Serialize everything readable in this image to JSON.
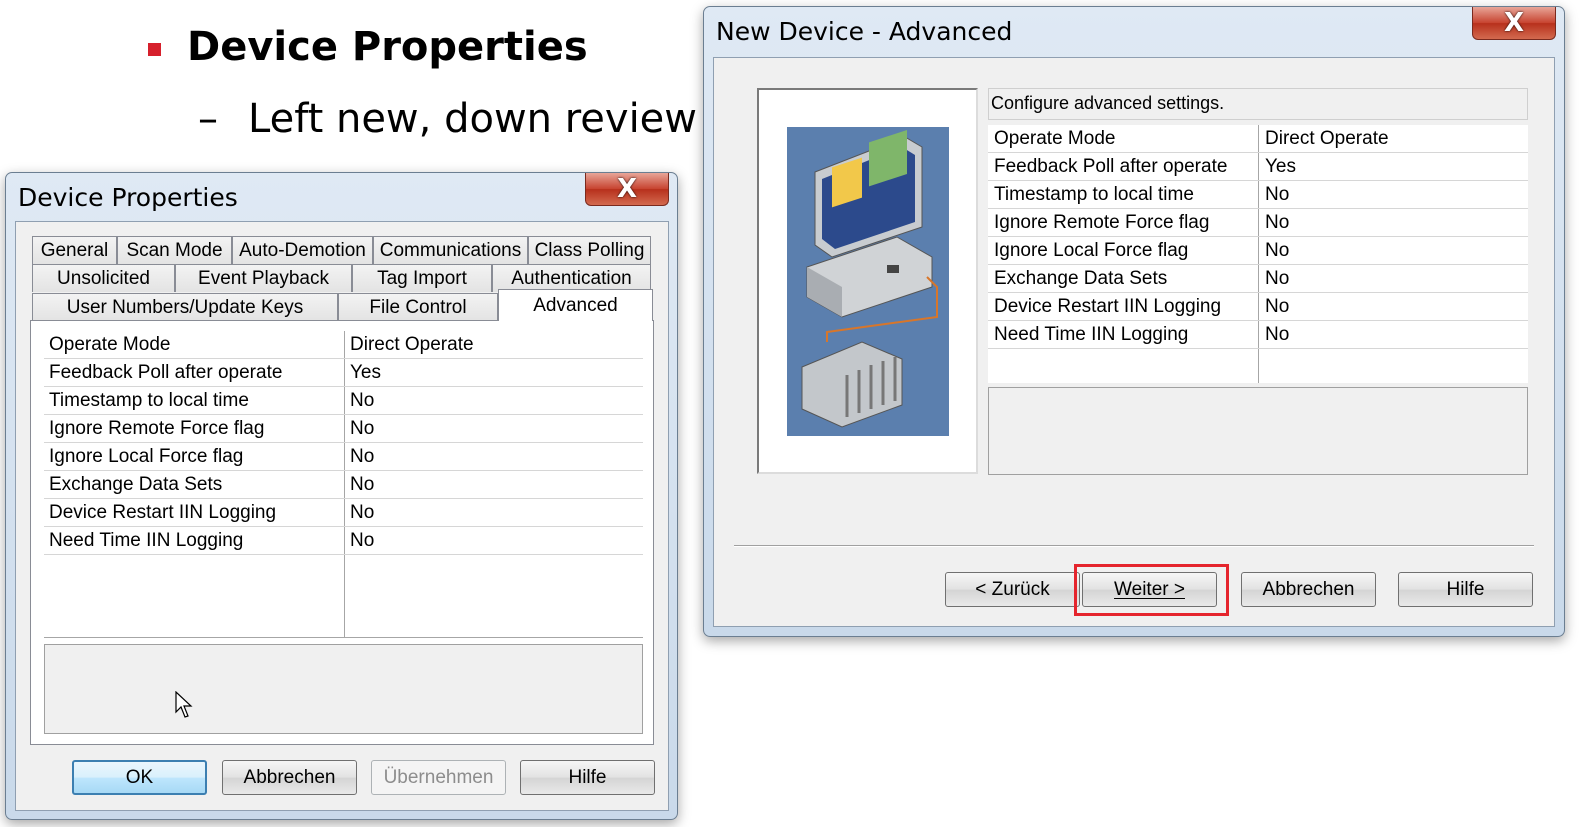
{
  "slide": {
    "bullet": "Device Properties",
    "sub_dash": "–",
    "sub": "Left new, down review"
  },
  "device_properties": {
    "title": "Device Properties",
    "close_label": "X",
    "tabs_row1": [
      "General",
      "Scan Mode",
      "Auto-Demotion",
      "Communications",
      "Class Polling"
    ],
    "tabs_row2": [
      "Unsolicited",
      "Event Playback",
      "Tag Import",
      "Authentication"
    ],
    "tabs_row3": [
      "User Numbers/Update Keys",
      "File Control",
      "Advanced"
    ],
    "active_tab": "Advanced",
    "properties": [
      {
        "name": "Operate Mode",
        "value": "Direct Operate"
      },
      {
        "name": "Feedback Poll after operate",
        "value": "Yes"
      },
      {
        "name": "Timestamp to local time",
        "value": "No"
      },
      {
        "name": "Ignore Remote Force flag",
        "value": "No"
      },
      {
        "name": "Ignore Local Force flag",
        "value": "No"
      },
      {
        "name": "Exchange Data Sets",
        "value": "No"
      },
      {
        "name": "Device Restart IIN Logging",
        "value": "No"
      },
      {
        "name": "Need Time IIN Logging",
        "value": "No"
      }
    ],
    "buttons": {
      "ok": "OK",
      "cancel": "Abbrechen",
      "apply": "Übernehmen",
      "help": "Hilfe"
    }
  },
  "new_device": {
    "title": "New Device - Advanced",
    "close_label": "X",
    "heading": "Configure advanced settings.",
    "properties": [
      {
        "name": "Operate Mode",
        "value": "Direct Operate"
      },
      {
        "name": "Feedback Poll after operate",
        "value": "Yes"
      },
      {
        "name": "Timestamp to local time",
        "value": "No"
      },
      {
        "name": "Ignore Remote Force flag",
        "value": "No"
      },
      {
        "name": "Ignore Local Force flag",
        "value": "No"
      },
      {
        "name": "Exchange Data Sets",
        "value": "No"
      },
      {
        "name": "Device Restart IIN Logging",
        "value": "No"
      },
      {
        "name": "Need Time IIN Logging",
        "value": "No"
      }
    ],
    "buttons": {
      "back": "< Zurück",
      "next": "Weiter >",
      "cancel": "Abbrechen",
      "help": "Hilfe"
    },
    "highlight_color": "#e5252d"
  }
}
